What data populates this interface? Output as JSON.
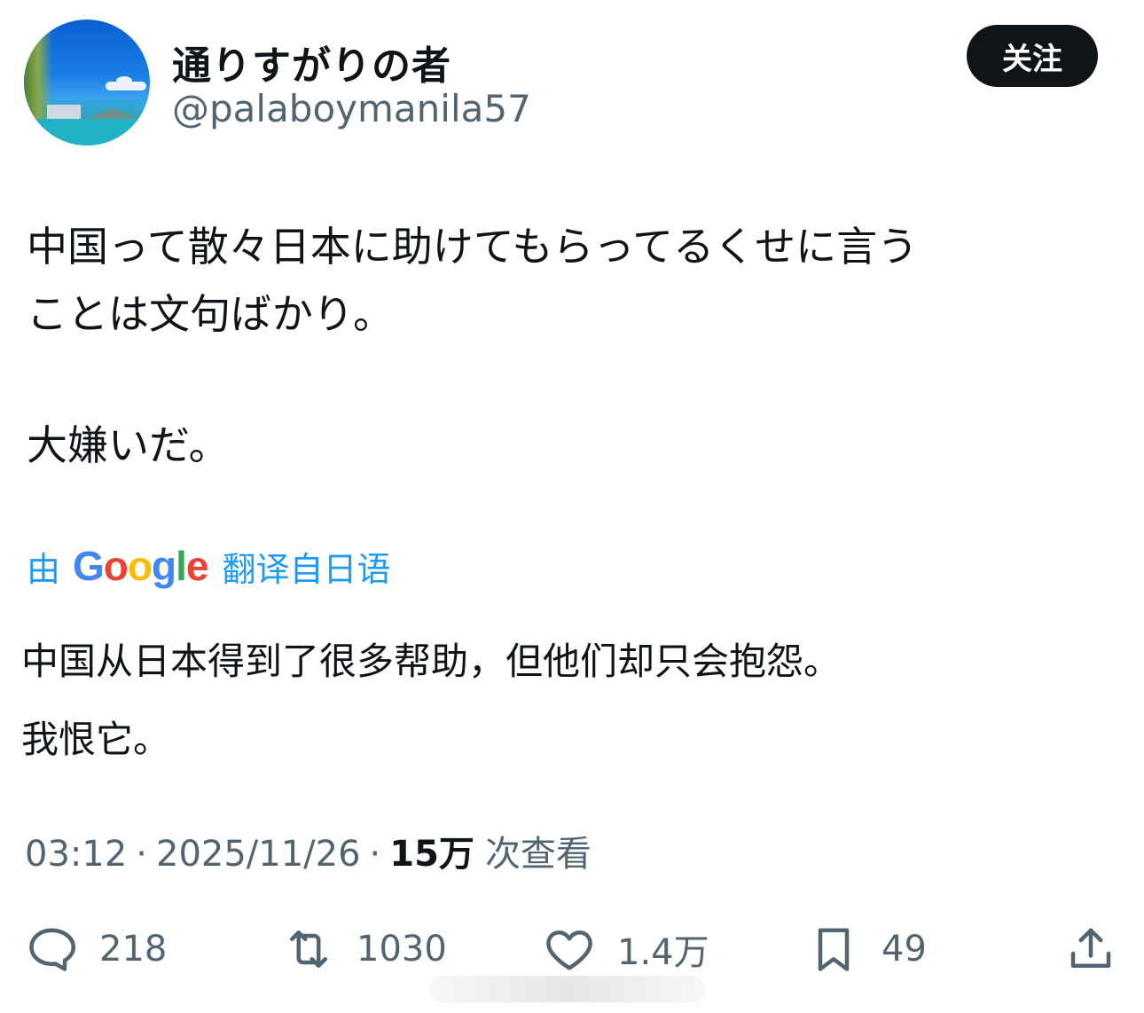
{
  "author": {
    "display_name": "通りすがりの者",
    "handle": "@palaboymanila57"
  },
  "follow_label": "关注",
  "tweet": {
    "line1": "中国って散々日本に助けてもらってるくせに言う",
    "line2": "ことは文句ばかり。",
    "line3": "大嫌いだ。"
  },
  "translation": {
    "prefix": "由",
    "google": [
      "G",
      "o",
      "o",
      "g",
      "l",
      "e"
    ],
    "google_colors": [
      "#4285F4",
      "#EA4335",
      "#FBBC05",
      "#4285F4",
      "#34A853",
      "#EA4335"
    ],
    "suffix": "翻译自日语",
    "line1": "中国从日本得到了很多帮助，但他们却只会抱怨。",
    "line2": "我恨它。"
  },
  "meta": {
    "time": "03:12",
    "separator": "·",
    "date": "2025/11/26",
    "views_count": "15万",
    "views_label": "次查看"
  },
  "actions": {
    "reply_count": "218",
    "retweet_count": "1030",
    "like_count": "1.4万",
    "bookmark_count": "49"
  },
  "icons": [
    "reply-icon",
    "retweet-icon",
    "heart-icon",
    "bookmark-icon",
    "share-icon"
  ],
  "colors": {
    "accent": "#1d9bf0",
    "text": "#0f1419",
    "muted": "#536471"
  }
}
